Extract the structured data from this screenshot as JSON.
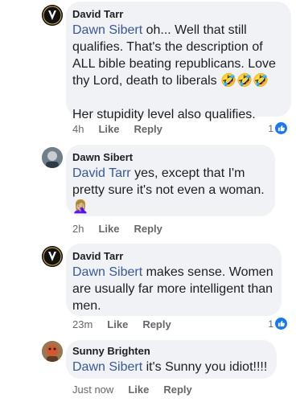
{
  "comments": [
    {
      "author": "David Tarr",
      "mention": "Dawn Sibert",
      "text_line1": " oh... Well that still",
      "text_line2": "qualifies. That's the description of",
      "text_line3": "ALL bible beating republicans. Love",
      "text_line4": "thy Lord, death to liberals ",
      "emojis": "🤣🤣🤣",
      "text_line5": "Her stupidity level also qualifies.",
      "time": "4h",
      "like_label": "Like",
      "reply_label": "Reply",
      "reaction_count": "1"
    },
    {
      "author": "Dawn Sibert",
      "mention": "David Tarr",
      "text_line1": " yes, except that I'm",
      "text_line2": "pretty sure it's not even a woman.",
      "emojis": "🤦🏼‍♀️",
      "time": "2h",
      "like_label": "Like",
      "reply_label": "Reply"
    },
    {
      "author": "David Tarr",
      "mention": "Dawn Sibert",
      "text_line1": " makes sense. Women",
      "text_line2": "are usually far more intelligent than",
      "text_line3": "men.",
      "time": "23m",
      "like_label": "Like",
      "reply_label": "Reply",
      "reaction_count": "1"
    },
    {
      "author": "Sunny Brighten",
      "mention": "Dawn Sibert",
      "text_line1": " it's Sunny you idiot!!!!",
      "time": "Just now",
      "like_label": "Like",
      "reply_label": "Reply"
    }
  ],
  "colors": {
    "bubble": "#f0f2f5",
    "mention": "#385898",
    "meta": "#65676b",
    "like": "#1877f2"
  }
}
